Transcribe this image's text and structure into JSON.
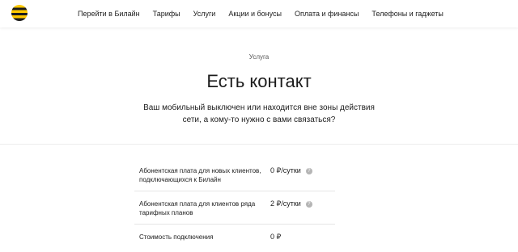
{
  "header": {
    "logo_icon": "beeline-logo-icon",
    "nav": [
      "Перейти в Билайн",
      "Тарифы",
      "Услуги",
      "Акции и бонусы",
      "Оплата и финансы",
      "Телефоны и гаджеты"
    ]
  },
  "hero": {
    "eyebrow": "Услуга",
    "title": "Есть контакт",
    "subtitle": "Ваш мобильный выключен или находится вне зоны действия сети, а кому-то нужно с вами связаться?"
  },
  "prices": [
    {
      "label": "Абонентская плата для новых клиентов, подключающихся к Билайн",
      "value": "0 ₽/сутки",
      "help_icon": "question-icon"
    },
    {
      "label": "Абонентская плата для клиентов ряда тарифных планов",
      "value": "2 ₽/сутки",
      "help_icon": "question-icon"
    },
    {
      "label": "Стоимость подключения",
      "value": "0 ₽"
    }
  ],
  "colors": {
    "brand_yellow": "#ffc800",
    "brand_black": "#1c1c1c",
    "help_icon": "#b5b5b5"
  }
}
